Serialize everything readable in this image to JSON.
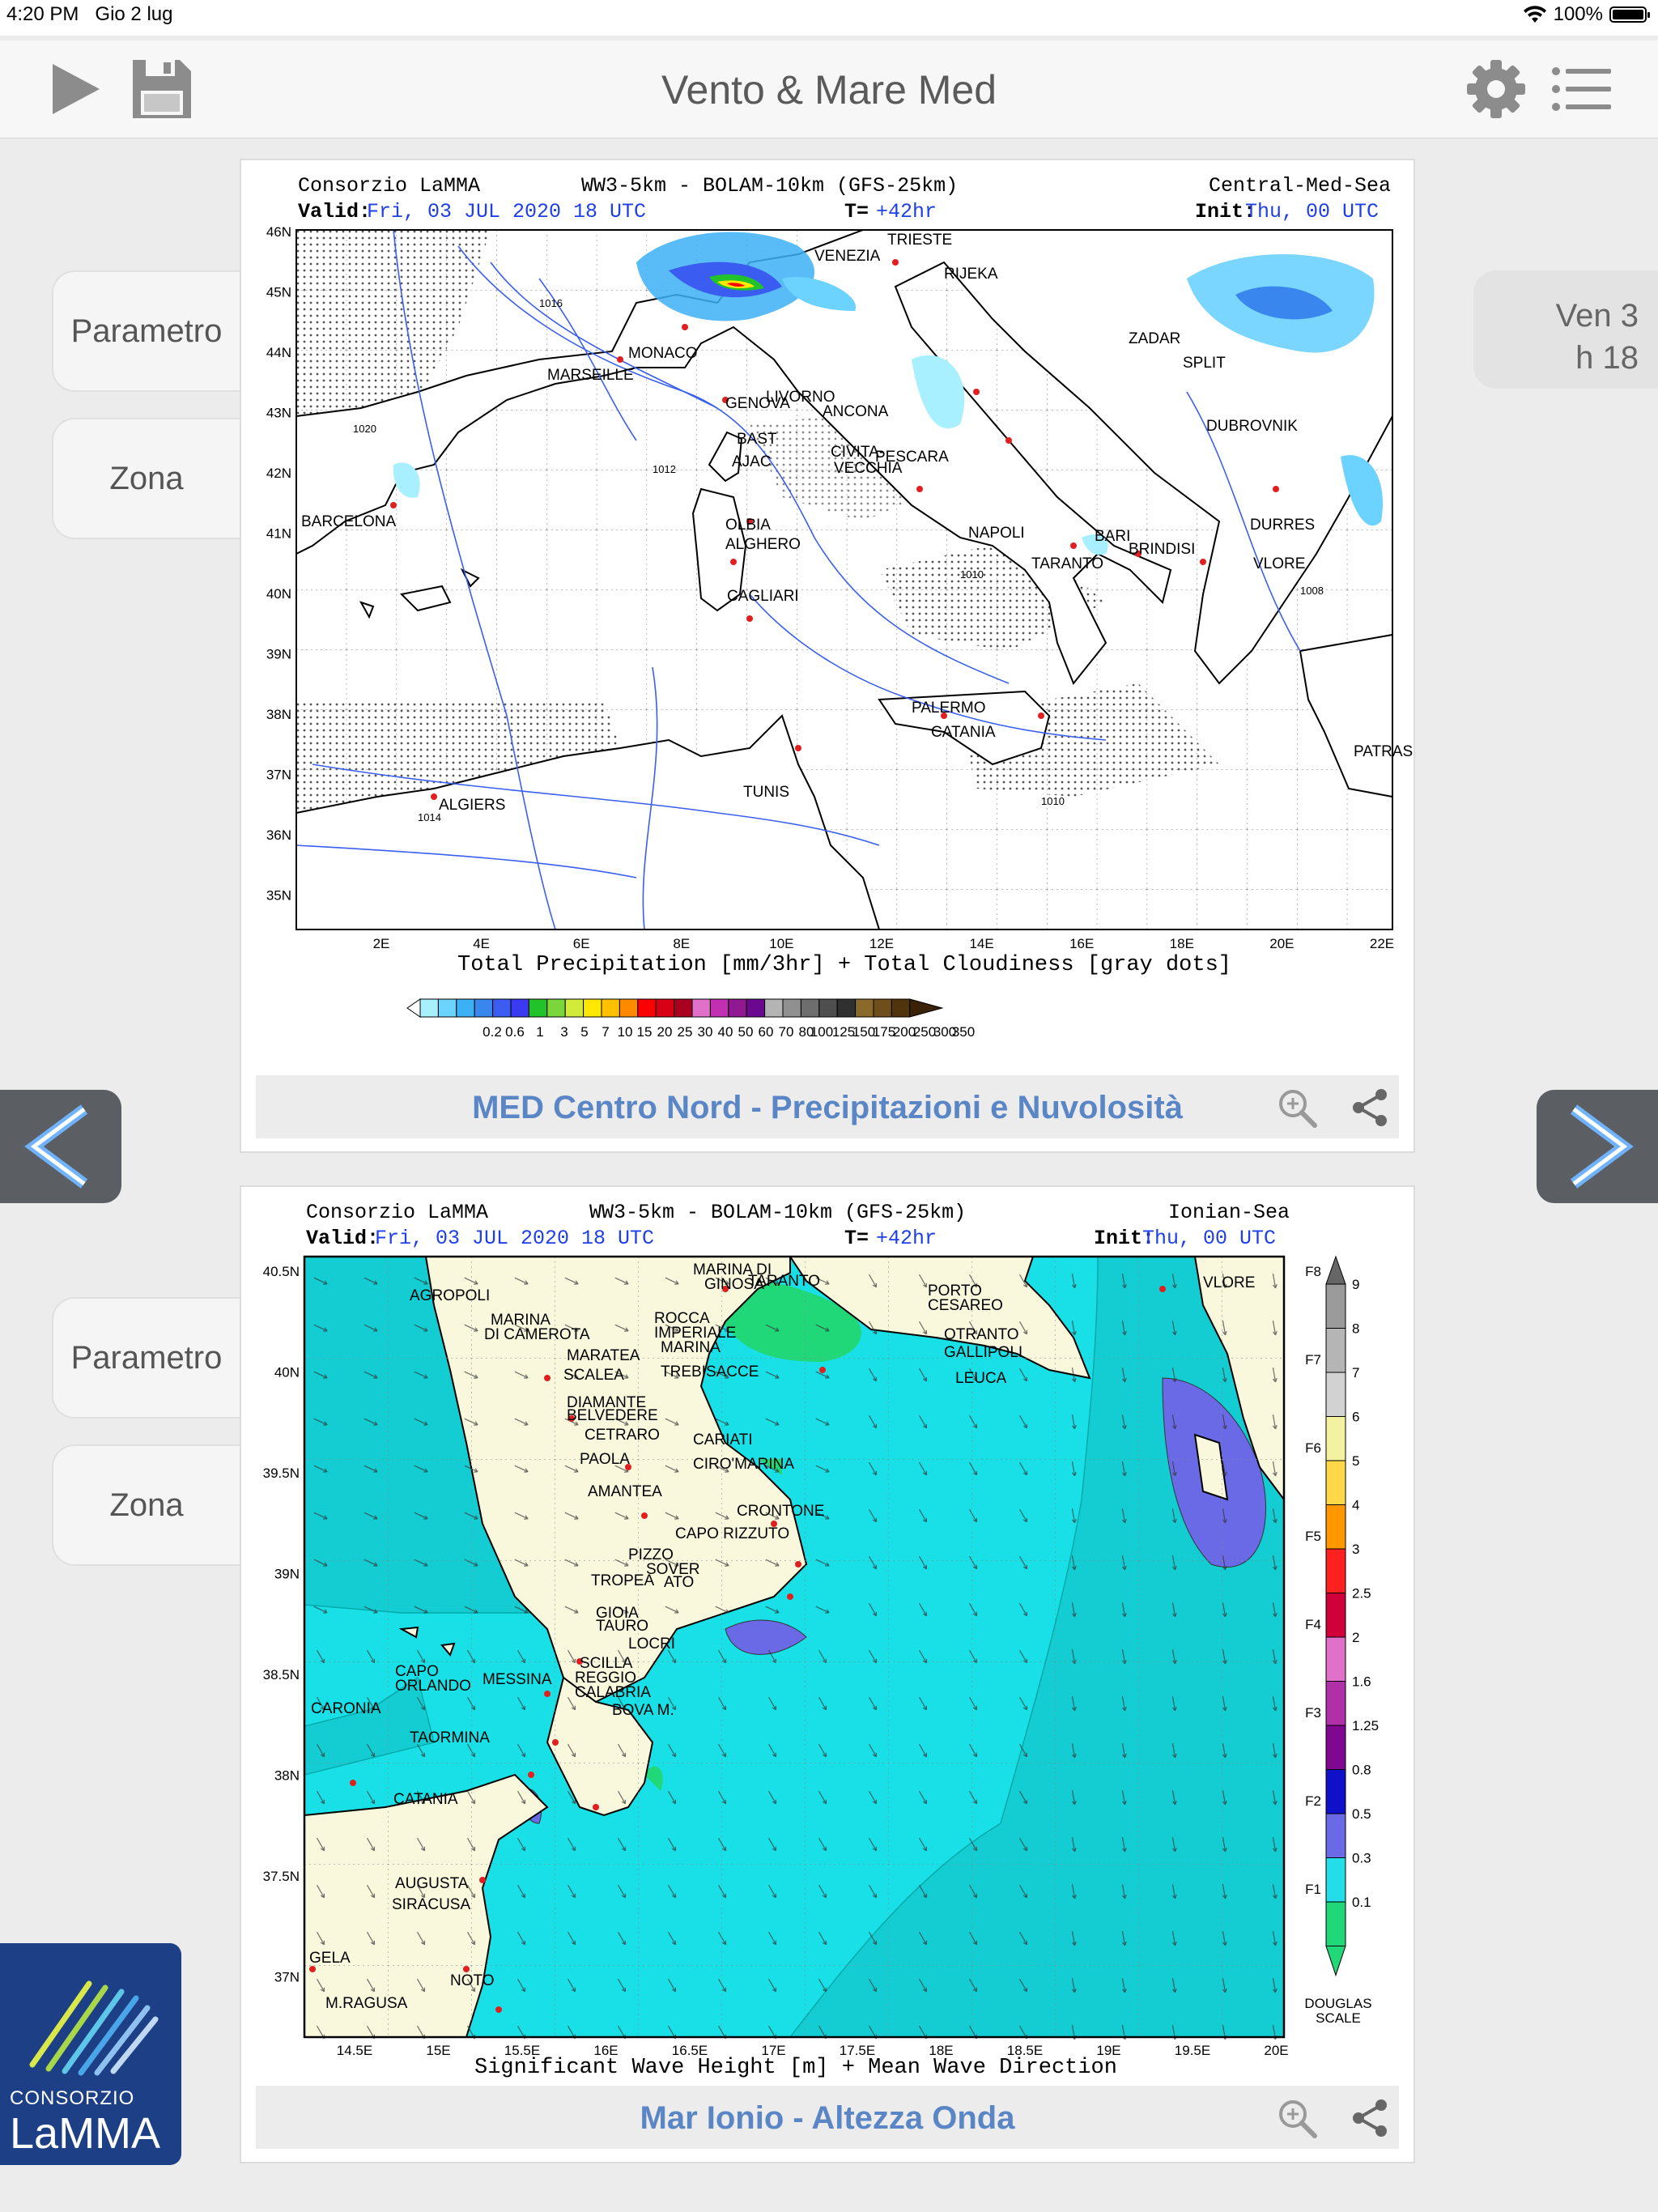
{
  "status_bar": {
    "time": "4:20 PM",
    "date": "Gio 2 lug",
    "battery": "100%"
  },
  "header": {
    "title": "Vento & Mare Med",
    "icons": [
      "play-icon",
      "save-icon",
      "gear-icon",
      "list-icon"
    ]
  },
  "time_selector": {
    "day": "Ven 3",
    "hour": "h 18"
  },
  "side_tabs": {
    "parameter": "Parametro",
    "zone": "Zona"
  },
  "panel1": {
    "caption": "MED Centro Nord - Precipitazioni e Nuvolosità",
    "map": {
      "provider": "Consorzio LaMMA",
      "model": "WW3-5km  -  BOLAM-10km (GFS-25km)",
      "region": "Central-Med-Sea",
      "valid_label": "Valid:",
      "valid_value": "Fri, 03 JUL 2020   18 UTC",
      "t_label": "T=",
      "t_value": "+42hr",
      "init_label": "Init:",
      "init_value": "Thu, 00 UTC",
      "lat_ticks": [
        "46N",
        "45N",
        "44N",
        "43N",
        "42N",
        "41N",
        "40N",
        "39N",
        "38N",
        "37N",
        "36N",
        "35N"
      ],
      "lon_ticks": [
        "2E",
        "4E",
        "6E",
        "8E",
        "10E",
        "12E",
        "14E",
        "16E",
        "18E",
        "20E",
        "22E"
      ],
      "xlabel": "Total Precipitation [mm/3hr] + Total Cloudiness [gray dots]",
      "colorbar_labels": [
        "0.2",
        "0.6",
        "1",
        "3",
        "5",
        "7",
        "10",
        "15",
        "20",
        "25",
        "30",
        "40",
        "50",
        "60",
        "70",
        "80",
        "100",
        "125",
        "150",
        "175",
        "200",
        "250",
        "300",
        "350"
      ],
      "colorbar_colors": [
        "#ffffff",
        "#a8f0ff",
        "#6cd2ff",
        "#3cb0f5",
        "#3a86ef",
        "#3a5cf0",
        "#3a3af0",
        "#22c22a",
        "#7ad63a",
        "#d2ea3a",
        "#ffe800",
        "#ffc000",
        "#ff8a00",
        "#ff0000",
        "#d80014",
        "#aa0020",
        "#e070c8",
        "#c030b0",
        "#901890",
        "#6a0890",
        "#b4b4b4",
        "#909090",
        "#6e6e6e",
        "#4e4e4e",
        "#303030",
        "#8a6a2a",
        "#6e4e1a",
        "#50340e",
        "#3a2208"
      ],
      "places": [
        "VENEZIA",
        "TRIESTE",
        "RIJEKA",
        "GENOVA",
        "MONACO",
        "MARSEILLE",
        "LIVORNO",
        "ZADAR",
        "SPLIT",
        "ANCONA",
        "DUBROVNIK",
        "BAST",
        "AJAC",
        "PESCARA",
        "CIVITA-",
        "VECCHIA",
        "BARCELONA",
        "OLBIA",
        "ALGHERO",
        "NAPOLI",
        "BARI",
        "BRINDISI",
        "DURRES",
        "TARANTO",
        "VLORE",
        "CAGLIARI",
        "PALERMO",
        "PATRAS",
        "CATANIA",
        "ALGIERS",
        "TUNIS"
      ],
      "isobars": [
        "1016",
        "1012",
        "1010",
        "1008",
        "1014",
        "1020",
        "1010"
      ]
    }
  },
  "panel2": {
    "caption": "Mar Ionio - Altezza Onda",
    "map": {
      "provider": "Consorzio LaMMA",
      "model": "WW3-5km  -  BOLAM-10km (GFS-25km)",
      "region": "Ionian-Sea",
      "valid_label": "Valid:",
      "valid_value": "Fri, 03 JUL 2020   18 UTC",
      "t_label": "T=",
      "t_value": "+42hr",
      "init_label": "Init:",
      "init_value": "Thu, 00 UTC",
      "lat_ticks": [
        "40.5N",
        "40N",
        "39.5N",
        "39N",
        "38.5N",
        "38N",
        "37.5N",
        "37N"
      ],
      "lon_ticks": [
        "14.5E",
        "15E",
        "15.5E",
        "16E",
        "16.5E",
        "17E",
        "17.5E",
        "18E",
        "18.5E",
        "19E",
        "19.5E",
        "20E"
      ],
      "xlabel": "Significant Wave Height [m] + Mean Wave Direction",
      "colorbar_values": [
        "9",
        "8",
        "7",
        "6",
        "5",
        "4",
        "3",
        "2.5",
        "2",
        "1.6",
        "1.25",
        "0.8",
        "0.5",
        "0.3",
        "0.1"
      ],
      "colorbar_colors": [
        "#9b9b9b",
        "#b5b5b5",
        "#d2d2d2",
        "#f2f2a0",
        "#ffd84a",
        "#ff9800",
        "#ff2020",
        "#d0003a",
        "#e070c8",
        "#b030a8",
        "#800890",
        "#1010c8",
        "#6a6ae6",
        "#24dde6",
        "#20d878"
      ],
      "douglas": [
        "F8",
        "F7",
        "F6",
        "F5",
        "F4",
        "F3",
        "F2",
        "F1"
      ],
      "douglas_label": "DOUGLAS",
      "douglas_label2": "SCALE",
      "places": [
        "MARINA DI",
        "GINOSA",
        "TARANTO",
        "AGROPOLI",
        "PORTO",
        "CESAREO",
        "VLORE",
        "MARINA",
        "DI CAMEROTA",
        "ROCCA",
        "IMPERIALE",
        "MARINA",
        "OTRANTO",
        "GALLIPOLI",
        "MARATEA",
        "TREBISACCE",
        "SCALEA",
        "LEUCA",
        "DIAMANTE",
        "BELVEDERE",
        "CETRARO",
        "CARIATI",
        "PAOLA",
        "CIRO'MARINA",
        "AMANTEA",
        "CRONTONE",
        "CAPO RIZZUTO",
        "PIZZO",
        "SOVER",
        "ATO",
        "TROPEA",
        "GIOIA",
        "TAURO",
        "LOCRI",
        "SCILLA",
        "REGGIO",
        "CALABRIA",
        "CAPO",
        "ORLANDO",
        "MESSINA",
        "CARONIA",
        "BOVA M.",
        "TAORMINA",
        "CATANIA",
        "AUGUSTA",
        "SIRACUSA",
        "GELA",
        "NOTO",
        "M.RAGUSA"
      ]
    }
  },
  "logo": {
    "line1": "CONSORZIO",
    "line2": "LaMMA"
  }
}
